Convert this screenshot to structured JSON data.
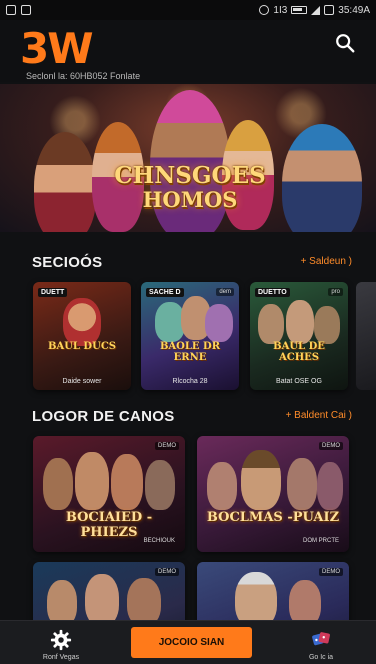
{
  "status_bar": {
    "time": "35:49A",
    "signal": "1I3"
  },
  "header": {
    "logo": "3W",
    "subline": "Seclonl la: 60HB052 Fonlate"
  },
  "hero": {
    "title_line1": "CHNSGOES",
    "title_line2": "HOMOS"
  },
  "section1": {
    "title": "SECIOÓS",
    "more": "+ Saldeun )",
    "cards": [
      {
        "badge": "DUETT",
        "badge_right": "",
        "title": "BAUL DUCS",
        "caption": "Daide sower"
      },
      {
        "badge": "SACHE D",
        "badge_right": "dem",
        "title": "BAOLE DR ERNE",
        "caption": "Rlcocha 28"
      },
      {
        "badge": "DUETTO",
        "badge_right": "pro",
        "title": "BAUL DE ACHES",
        "caption": "Batat OSE OG"
      }
    ]
  },
  "section2": {
    "title": "LOGOR DE CANOS",
    "more": "+ Baldent Cai )",
    "cards": [
      {
        "badge_right": "DEMO",
        "title": "BOCIAIED -PHIEZS",
        "caption": "BECHIOUK"
      },
      {
        "badge_right": "DEMO",
        "title": "BOCLMAS -PUAIZ",
        "caption": "DOM PRCTE"
      },
      {
        "badge_right": "DEMO",
        "title": "",
        "caption": ""
      },
      {
        "badge_right": "DEMO",
        "title": "",
        "caption": ""
      }
    ]
  },
  "bottom_nav": {
    "left_label": "Ronf Vegas",
    "cta": "JOCOIO SIAN",
    "right_label": "Go Ic ia"
  },
  "colors": {
    "accent": "#ff7a1a",
    "background": "#101113"
  }
}
